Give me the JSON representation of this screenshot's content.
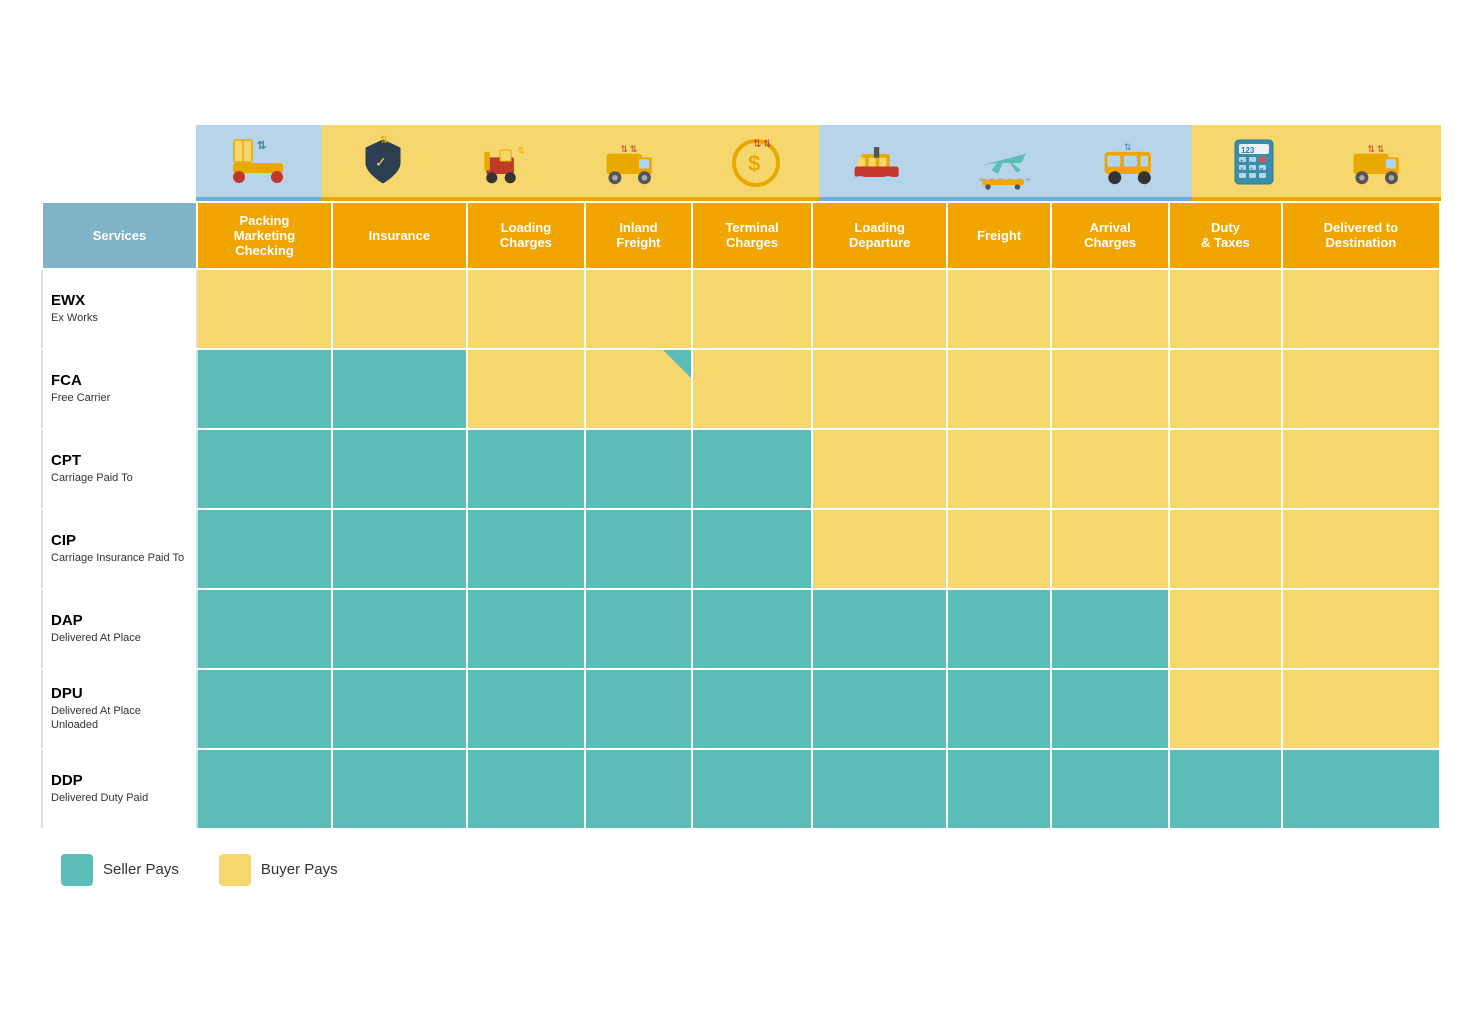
{
  "icons": [
    {
      "id": "empty",
      "type": "empty"
    },
    {
      "id": "packing",
      "type": "blue",
      "emoji": "📦",
      "label": "Packing"
    },
    {
      "id": "insurance",
      "type": "gold",
      "emoji": "🛡",
      "label": "Insurance"
    },
    {
      "id": "loading-charges",
      "type": "gold",
      "emoji": "🚜",
      "label": "Loading"
    },
    {
      "id": "inland-freight",
      "type": "gold",
      "emoji": "🚛",
      "label": "Inland"
    },
    {
      "id": "terminal-charges",
      "type": "gold",
      "emoji": "💲",
      "label": "Terminal"
    },
    {
      "id": "loading-departure",
      "type": "blue",
      "emoji": "🚢",
      "label": "Loading Dep"
    },
    {
      "id": "freight",
      "type": "blue",
      "emoji": "✈",
      "label": "Freight"
    },
    {
      "id": "arrival-charges",
      "type": "blue",
      "emoji": "🚌",
      "label": "Arrival"
    },
    {
      "id": "duty-taxes",
      "type": "gold",
      "emoji": "🧮",
      "label": "Duty"
    },
    {
      "id": "delivered",
      "type": "gold",
      "emoji": "🚛",
      "label": "Delivered"
    }
  ],
  "headers": {
    "services": "Services",
    "columns": [
      "Packing Marketing Checking",
      "Insurance",
      "Loading Charges",
      "Inland Freight",
      "Terminal Charges",
      "Loading Departure",
      "Freight",
      "Arrival Charges",
      "Duty & Taxes",
      "Delivered to Destination"
    ]
  },
  "rows": [
    {
      "code": "EWX",
      "name": "Ex Works",
      "cells": [
        "buyer",
        "buyer",
        "buyer",
        "buyer",
        "buyer",
        "buyer",
        "buyer",
        "buyer",
        "buyer",
        "buyer"
      ]
    },
    {
      "code": "FCA",
      "name": "Free Carrier",
      "cells": [
        "seller",
        "seller",
        "buyer",
        "note",
        "buyer",
        "buyer",
        "buyer",
        "buyer",
        "buyer",
        "buyer"
      ]
    },
    {
      "code": "CPT",
      "name": "Carriage Paid To",
      "cells": [
        "seller",
        "seller",
        "seller",
        "seller",
        "seller",
        "buyer",
        "buyer",
        "buyer",
        "buyer",
        "buyer"
      ]
    },
    {
      "code": "CIP",
      "name": "Carriage Insurance Paid To",
      "cells": [
        "seller",
        "seller",
        "seller",
        "seller",
        "seller",
        "buyer",
        "buyer",
        "buyer",
        "buyer",
        "buyer"
      ]
    },
    {
      "code": "DAP",
      "name": "Delivered At Place",
      "cells": [
        "seller",
        "seller",
        "seller",
        "seller",
        "seller",
        "seller",
        "seller",
        "seller",
        "buyer",
        "buyer"
      ]
    },
    {
      "code": "DPU",
      "name": "Delivered At Place Unloaded",
      "cells": [
        "seller",
        "seller",
        "seller",
        "seller",
        "seller",
        "seller",
        "seller",
        "seller",
        "buyer",
        "buyer"
      ]
    },
    {
      "code": "DDP",
      "name": "Delivered Duty Paid",
      "cells": [
        "seller",
        "seller",
        "seller",
        "seller",
        "seller",
        "seller",
        "seller",
        "seller",
        "seller",
        "seller"
      ]
    }
  ],
  "legend": {
    "seller_label": "Seller Pays",
    "buyer_label": "Buyer Pays"
  }
}
